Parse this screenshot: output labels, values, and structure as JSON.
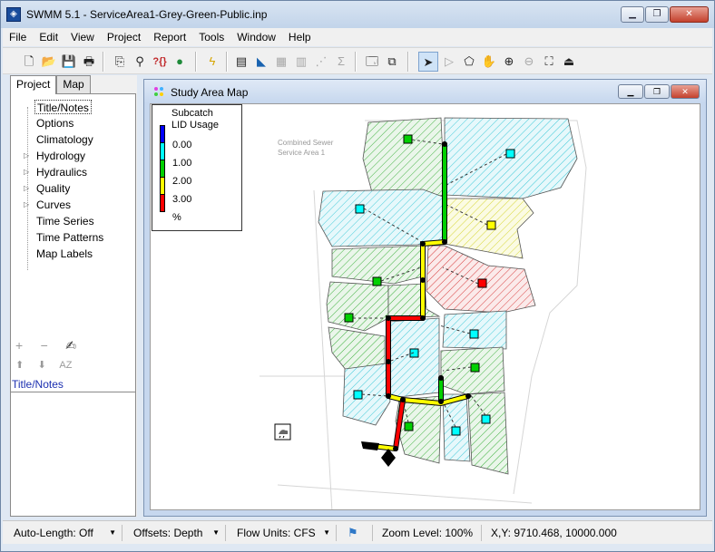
{
  "window": {
    "title": "SWMM 5.1 - ServiceArea1-Grey-Green-Public.inp",
    "controls": {
      "minimize": "▁",
      "maximize": "❐",
      "close": "✕"
    }
  },
  "menu": [
    "File",
    "Edit",
    "View",
    "Project",
    "Report",
    "Tools",
    "Window",
    "Help"
  ],
  "left_panel": {
    "tabs": [
      {
        "label": "Project",
        "active": true
      },
      {
        "label": "Map",
        "active": false
      }
    ],
    "tree": [
      {
        "label": "Title/Notes",
        "selected": true,
        "expandable": false
      },
      {
        "label": "Options",
        "expandable": false
      },
      {
        "label": "Climatology",
        "expandable": false
      },
      {
        "label": "Hydrology",
        "expandable": true
      },
      {
        "label": "Hydraulics",
        "expandable": true
      },
      {
        "label": "Quality",
        "expandable": true
      },
      {
        "label": "Curves",
        "expandable": true
      },
      {
        "label": "Time Series",
        "expandable": false
      },
      {
        "label": "Time Patterns",
        "expandable": false
      },
      {
        "label": "Map Labels",
        "expandable": false
      }
    ],
    "expander_glyph": "▷",
    "tools_row1": [
      "+",
      "−",
      "✍"
    ],
    "tools_row2": [
      "⬆",
      "⬇",
      "AZ"
    ],
    "property_label": "Title/Notes"
  },
  "map_window": {
    "title": "Study Area Map",
    "controls": {
      "minimize": "▁",
      "maximize": "❐",
      "close": "✕"
    },
    "legend": {
      "title_line1": "Subcatch",
      "title_line2": "LID Usage",
      "values": [
        "0.00",
        "1.00",
        "2.00",
        "3.00",
        "%"
      ],
      "colors": [
        "#0000ff",
        "#00ffff",
        "#00ff00",
        "#ffff00",
        "#ff0000"
      ]
    },
    "map_label_lines": [
      "Combined Sewer",
      "Service Area 1"
    ],
    "colors": {
      "cyan_fill": "#3fc9d8",
      "green_fill": "#3fb13f",
      "yellow_fill": "#d8d83f",
      "red_fill": "#d83f3f"
    }
  },
  "status": {
    "auto_length": "Auto-Length: Off",
    "offsets": "Offsets: Depth",
    "flow_units": "Flow Units: CFS",
    "zoom": "Zoom Level: 100%",
    "xy": "X,Y: 9710.468, 10000.000",
    "dropdown_arrow": "▼"
  }
}
